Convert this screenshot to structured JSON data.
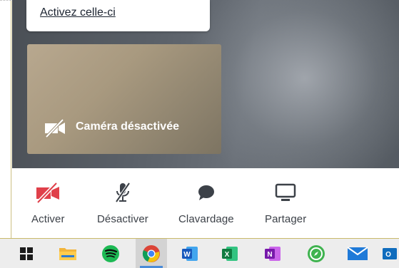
{
  "notice": {
    "link_text": "Activez celle-ci"
  },
  "camera": {
    "status_text": "Caméra désactivée"
  },
  "toolbar": {
    "items": [
      {
        "label": "Activer",
        "icon": "video-off-icon",
        "color": "#e0404a"
      },
      {
        "label": "Désactiver",
        "icon": "mic-off-icon",
        "color": "#3c4148"
      },
      {
        "label": "Clavardage",
        "icon": "chat-bubble-icon",
        "color": "#3c4148"
      },
      {
        "label": "Partager",
        "icon": "monitor-icon",
        "color": "#3c4148"
      }
    ]
  },
  "taskbar": {
    "apps": [
      {
        "icon": "windows-start-icon"
      },
      {
        "icon": "file-explorer-icon"
      },
      {
        "icon": "spotify-icon"
      },
      {
        "icon": "chrome-icon",
        "active": true
      },
      {
        "icon": "word-icon"
      },
      {
        "icon": "excel-icon"
      },
      {
        "icon": "onenote-icon"
      },
      {
        "icon": "green-compass-app-icon"
      },
      {
        "icon": "mail-icon"
      },
      {
        "icon": "outlook-icon"
      }
    ]
  }
}
